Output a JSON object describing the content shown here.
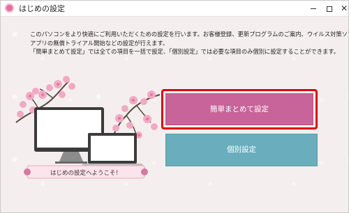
{
  "window": {
    "title": "はじめの設定",
    "controls": {
      "minimize_icon": "minimize-icon",
      "maximize_icon": "maximize-icon",
      "close_label": "✕"
    }
  },
  "intro": {
    "lines": [
      "このパソコンをより快適にご利用いただくための設定を行います。お客様登録、更新プログラムのご案内、ウイルス対策ソフ",
      "アプリの無償トライアル開始などの設定が行えます。",
      "「簡単まとめて設定」では全ての項目を一括で設定、「個別設定」では必要な項目のみ個別に設定することができます。"
    ]
  },
  "illustration": {
    "banner_text": "はじめの設定へようこそ！",
    "colors": {
      "blossom": "#f2a9c4",
      "blossom_dark": "#e07aa3",
      "branch": "#5a4a45",
      "device": "#3b3b3b"
    }
  },
  "buttons": {
    "simple": {
      "label": "簡単まとめて設定",
      "color": "#c8649a",
      "highlight": "#e00000"
    },
    "individual": {
      "label": "個別設定",
      "color": "#6aadbd"
    }
  }
}
